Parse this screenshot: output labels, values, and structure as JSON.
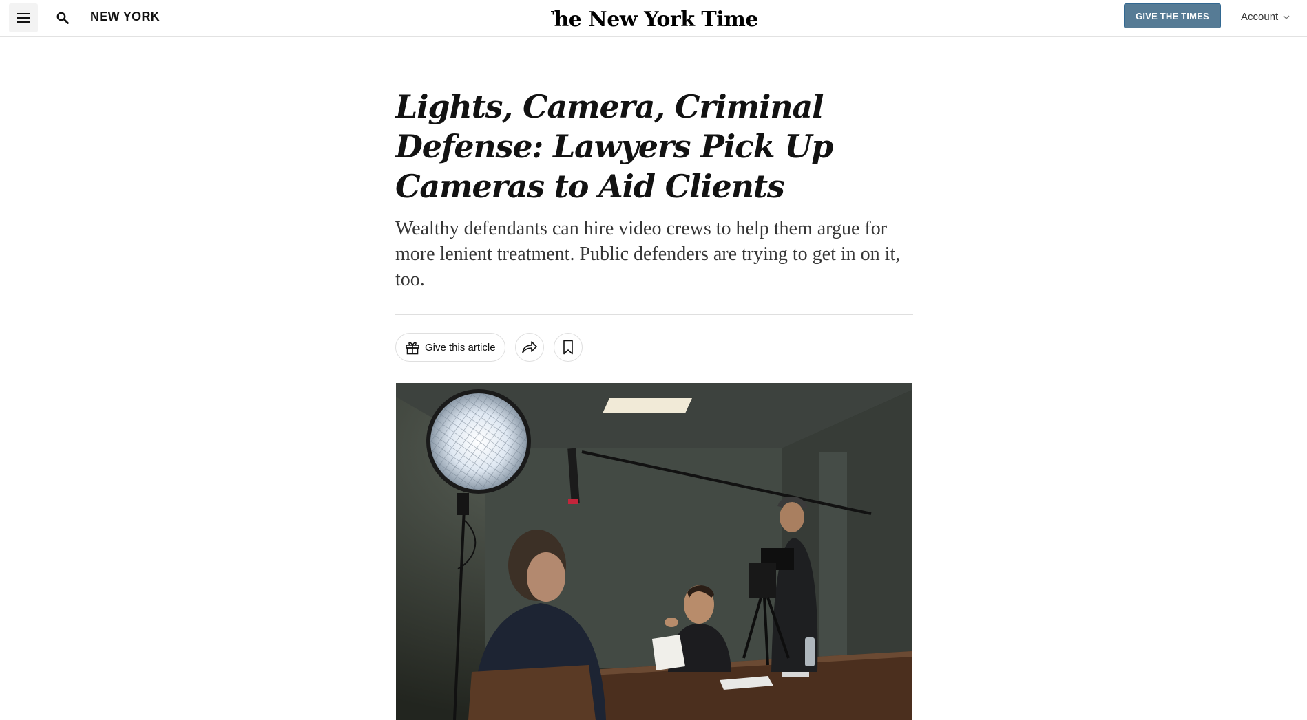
{
  "header": {
    "menu_icon": "hamburger-menu-icon",
    "search_icon": "search-icon",
    "section_label": "NEW YORK",
    "masthead_text": "The New York Times",
    "give_button_label": "GIVE THE TIMES",
    "account_label": "Account",
    "account_icon": "chevron-down-icon"
  },
  "article": {
    "headline": "Lights, Camera, Criminal Defense: Lawyers Pick Up Cameras to Aid Clients",
    "summary": "Wealthy defendants can hire video crews to help them argue for more lenient treatment. Public defenders are trying to get in on it, too."
  },
  "share_tools": {
    "gift_label": "Give this article",
    "gift_icon": "gift-icon",
    "share_icon": "share-arrow-icon",
    "save_icon": "bookmark-icon"
  },
  "colors": {
    "give_button_bg": "#567b95",
    "text": "#121212"
  }
}
